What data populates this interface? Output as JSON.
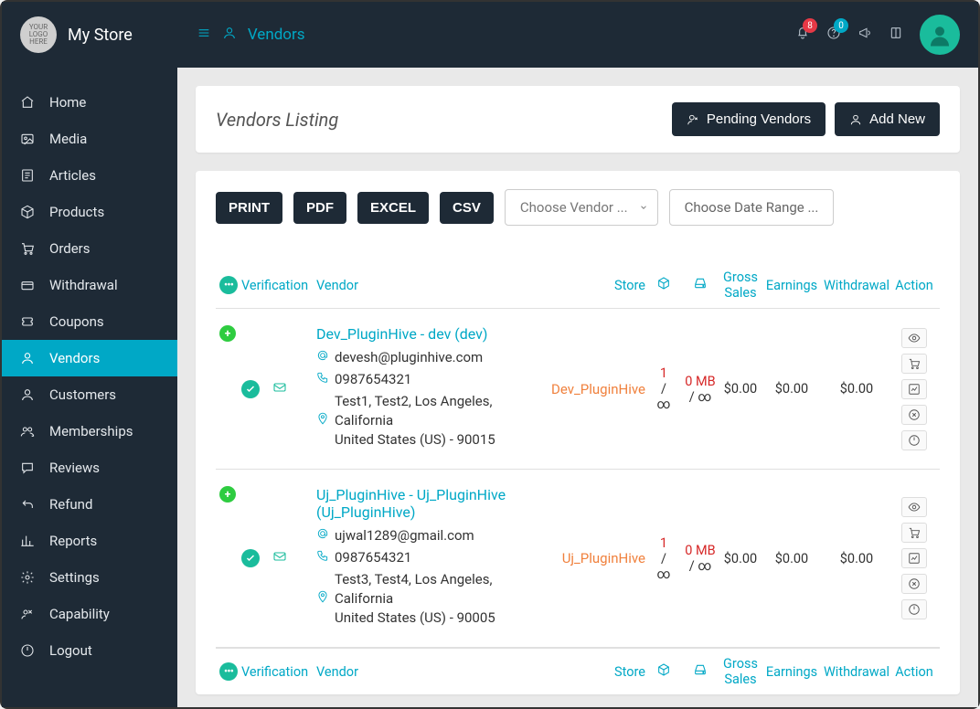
{
  "header": {
    "store_name": "My Store",
    "logo_text": "YOUR LOGO HERE",
    "breadcrumb": "Vendors",
    "bell_badge": "8",
    "help_badge": "0"
  },
  "sidebar": [
    {
      "label": "Home",
      "icon": "home"
    },
    {
      "label": "Media",
      "icon": "media"
    },
    {
      "label": "Articles",
      "icon": "articles"
    },
    {
      "label": "Products",
      "icon": "products"
    },
    {
      "label": "Orders",
      "icon": "orders"
    },
    {
      "label": "Withdrawal",
      "icon": "withdrawal"
    },
    {
      "label": "Coupons",
      "icon": "coupons"
    },
    {
      "label": "Vendors",
      "icon": "vendors"
    },
    {
      "label": "Customers",
      "icon": "customers"
    },
    {
      "label": "Memberships",
      "icon": "memberships"
    },
    {
      "label": "Reviews",
      "icon": "reviews"
    },
    {
      "label": "Refund",
      "icon": "refund"
    },
    {
      "label": "Reports",
      "icon": "reports"
    },
    {
      "label": "Settings",
      "icon": "settings"
    },
    {
      "label": "Capability",
      "icon": "capability"
    },
    {
      "label": "Logout",
      "icon": "logout"
    }
  ],
  "sidebar_active_index": 7,
  "listing": {
    "title": "Vendors Listing",
    "pending_button": "Pending Vendors",
    "addnew_button": "Add New",
    "export": {
      "print": "PRINT",
      "pdf": "PDF",
      "excel": "EXCEL",
      "csv": "CSV"
    },
    "choose_vendor_placeholder": "Choose Vendor ...",
    "choose_date_placeholder": "Choose Date Range ..."
  },
  "columns": {
    "verification": "Verification",
    "vendor": "Vendor",
    "store": "Store",
    "gross": "Gross Sales",
    "earnings": "Earnings",
    "withdrawal": "Withdrawal",
    "action": "Action"
  },
  "rows": [
    {
      "name": "Dev_PluginHive - dev (dev)",
      "email": "devesh@pluginhive.com",
      "phone": "0987654321",
      "address1": "Test1, Test2, Los Angeles, California",
      "address2": "United States (US) - 90015",
      "store": "Dev_PluginHive",
      "limit_top": "1",
      "limit_bot": "∞",
      "space_top": "0 MB",
      "space_bot": "/ ∞",
      "gross": "$0.00",
      "earnings": "$0.00",
      "withdrawal": "$0.00"
    },
    {
      "name": "Uj_PluginHive - Uj_PluginHive (Uj_PluginHive)",
      "email": "ujwal1289@gmail.com",
      "phone": "0987654321",
      "address1": "Test3, Test4, Los Angeles, California",
      "address2": "United States (US) - 90005",
      "store": "Uj_PluginHive",
      "limit_top": "1",
      "limit_bot": "∞",
      "space_top": "0 MB",
      "space_bot": "/ ∞",
      "gross": "$0.00",
      "earnings": "$0.00",
      "withdrawal": "$0.00"
    }
  ]
}
